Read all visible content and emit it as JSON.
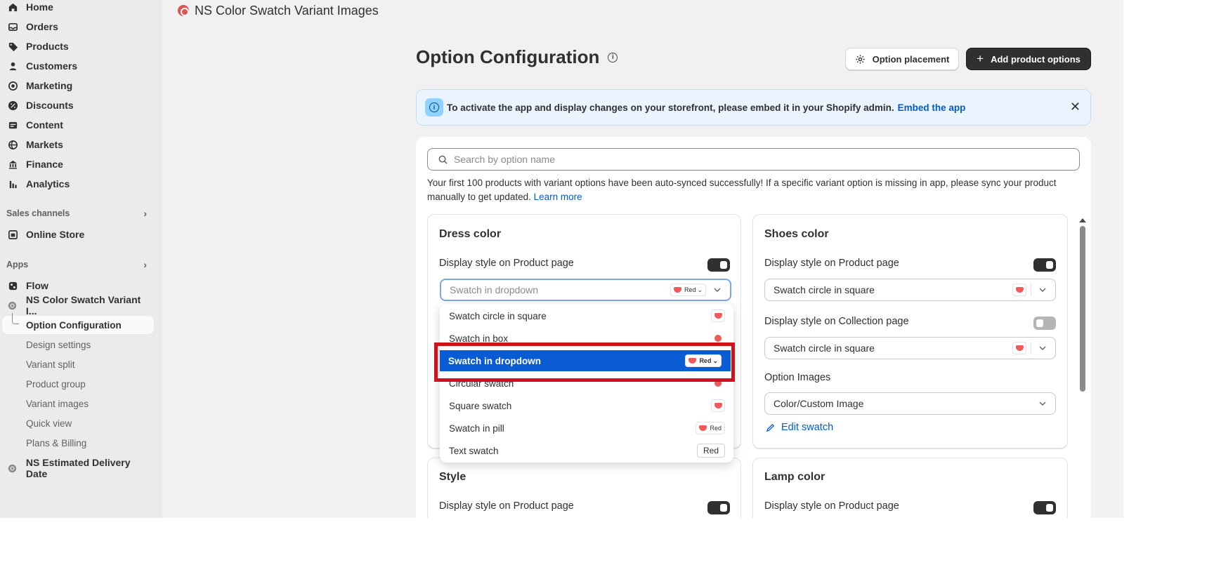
{
  "sidebar": {
    "main_items": [
      {
        "label": "Home",
        "icon": "home-icon"
      },
      {
        "label": "Orders",
        "icon": "orders-icon"
      },
      {
        "label": "Products",
        "icon": "tag-icon"
      },
      {
        "label": "Customers",
        "icon": "person-icon"
      },
      {
        "label": "Marketing",
        "icon": "target-icon"
      },
      {
        "label": "Discounts",
        "icon": "discount-icon"
      },
      {
        "label": "Content",
        "icon": "content-icon"
      },
      {
        "label": "Markets",
        "icon": "globe-icon"
      },
      {
        "label": "Finance",
        "icon": "bank-icon"
      },
      {
        "label": "Analytics",
        "icon": "bar-chart-icon"
      }
    ],
    "sales_channels_heading": "Sales channels",
    "online_store": "Online Store",
    "apps_heading": "Apps",
    "flow": "Flow",
    "ns_app": "NS Color Swatch Variant I...",
    "sub_items": [
      "Option Configuration",
      "Design settings",
      "Variant split",
      "Product group",
      "Variant images",
      "Quick view",
      "Plans & Billing"
    ],
    "ns_delivery": "NS Estimated Delivery Date"
  },
  "header": {
    "app_title": "NS Color Swatch Variant Images"
  },
  "page": {
    "title": "Option Configuration",
    "option_placement_button": "Option placement",
    "add_options_button": "Add product options"
  },
  "banner": {
    "text": "To activate the app and display changes on your storefront, please embed it in your Shopify admin.",
    "link": "Embed the app",
    "close": "✕"
  },
  "search": {
    "placeholder": "Search by option name"
  },
  "sync_notice": {
    "text": "Your first 100 products with variant options have been auto-synced successfully! If a specific variant option is missing in app, please sync your product manually to get updated.",
    "link": "Learn more"
  },
  "cards": {
    "dress": {
      "title": "Dress color",
      "product_label": "Display style on Product page",
      "product_select_value": "Swatch in dropdown",
      "product_toggle_on": true
    },
    "shoes": {
      "title": "Shoes color",
      "product_label": "Display style on Product page",
      "product_select_value": "Swatch circle in square",
      "product_toggle_on": true,
      "collection_label": "Display style on Collection page",
      "collection_select_value": "Swatch circle in square",
      "collection_toggle_on": false,
      "images_label": "Option Images",
      "images_select_value": "Color/Custom Image",
      "edit_link": "Edit swatch"
    },
    "style": {
      "title": "Style",
      "product_label": "Display style on Product page"
    },
    "lamp": {
      "title": "Lamp color",
      "product_label": "Display style on Product page"
    }
  },
  "dropdown": {
    "options": [
      {
        "label": "Swatch circle in square",
        "preview": "square-swatch"
      },
      {
        "label": "Swatch in box",
        "preview": "round-swatch"
      },
      {
        "label": "Swatch in dropdown",
        "preview": "pill-dropdown",
        "selected": true
      },
      {
        "label": "Circular swatch",
        "preview": "round-swatch"
      },
      {
        "label": "Square swatch",
        "preview": "square-swatch"
      },
      {
        "label": "Swatch in pill",
        "preview": "pill"
      },
      {
        "label": "Text swatch",
        "preview": "text"
      }
    ],
    "pill_text": "Red",
    "text_swatch_text": "Red"
  },
  "colors": {
    "swatch_red": "#ef5b5b",
    "selected_blue": "#0a5cd4",
    "highlight_red": "#d0121f",
    "primary_button": "#303030",
    "link_blue": "#005bd3"
  }
}
